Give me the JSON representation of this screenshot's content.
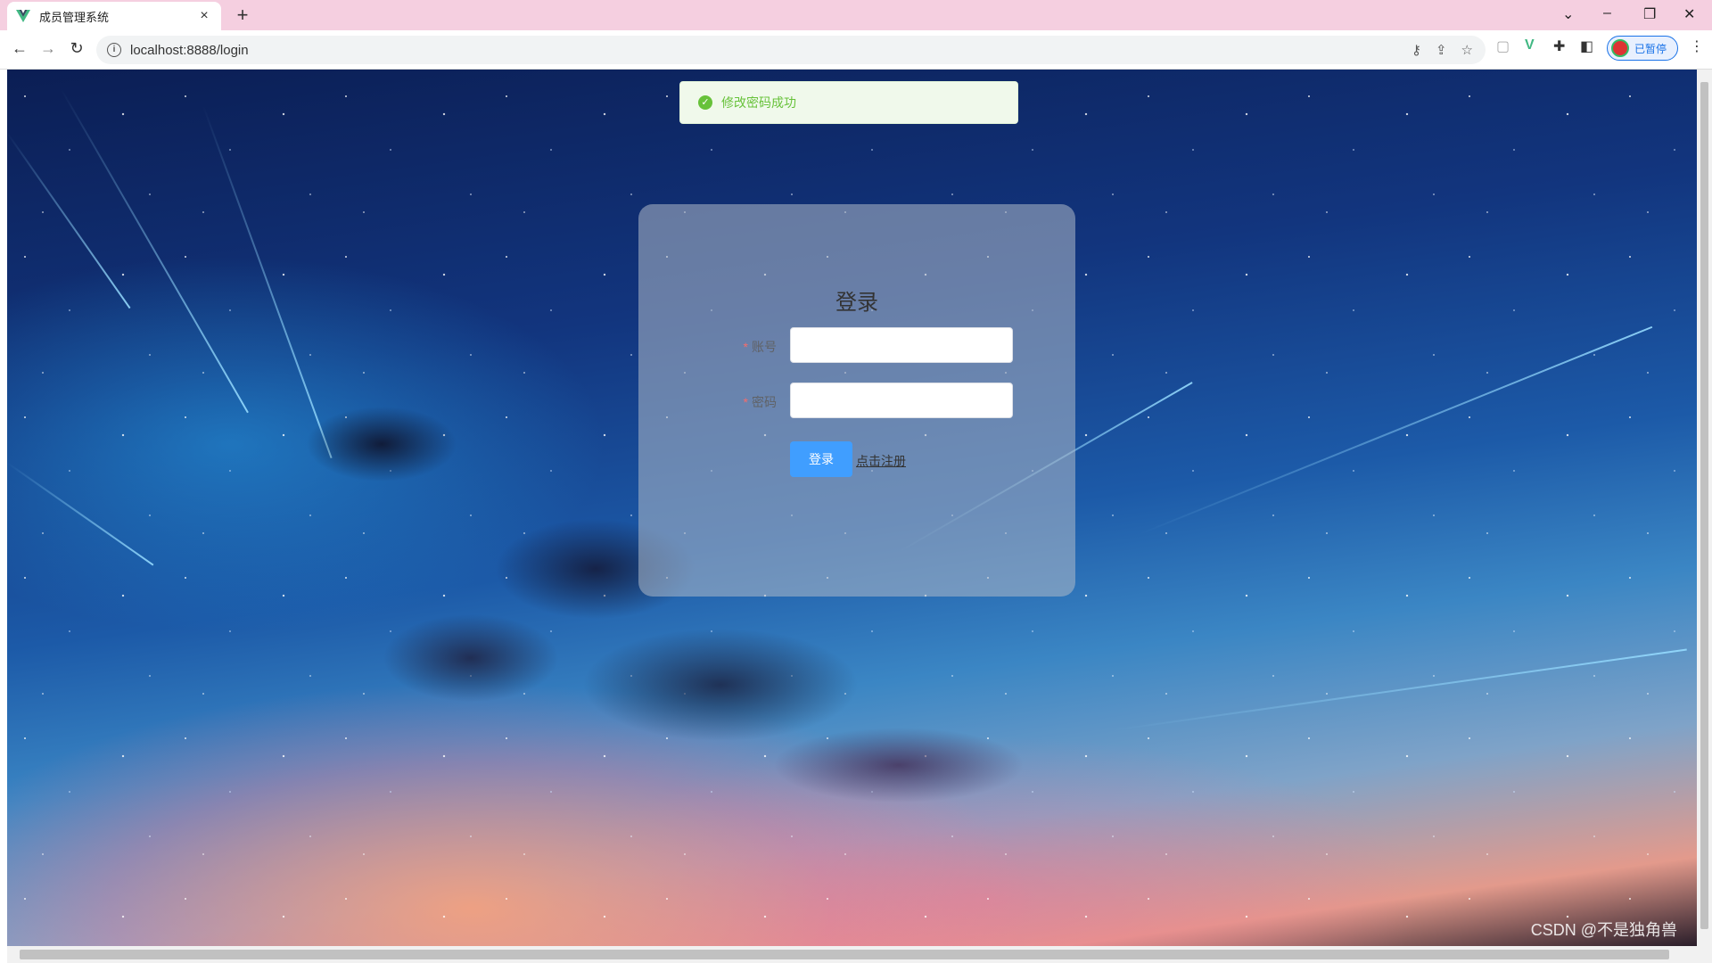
{
  "browser": {
    "tab_title": "成员管理系统",
    "tab_close": "×",
    "new_tab": "+",
    "url": "localhost:8888/login",
    "profile_label": "已暂停"
  },
  "notification": {
    "message": "修改密码成功",
    "type": "success"
  },
  "login": {
    "title": "登录",
    "account_label": "账号",
    "account_value": "",
    "password_label": "密码",
    "password_value": "",
    "submit_label": "登录",
    "register_link": "点击注册"
  },
  "watermark": "CSDN @不是独角兽",
  "colors": {
    "primary": "#409eff",
    "success": "#67c23a",
    "tab_strip": "#f5cfe0"
  }
}
